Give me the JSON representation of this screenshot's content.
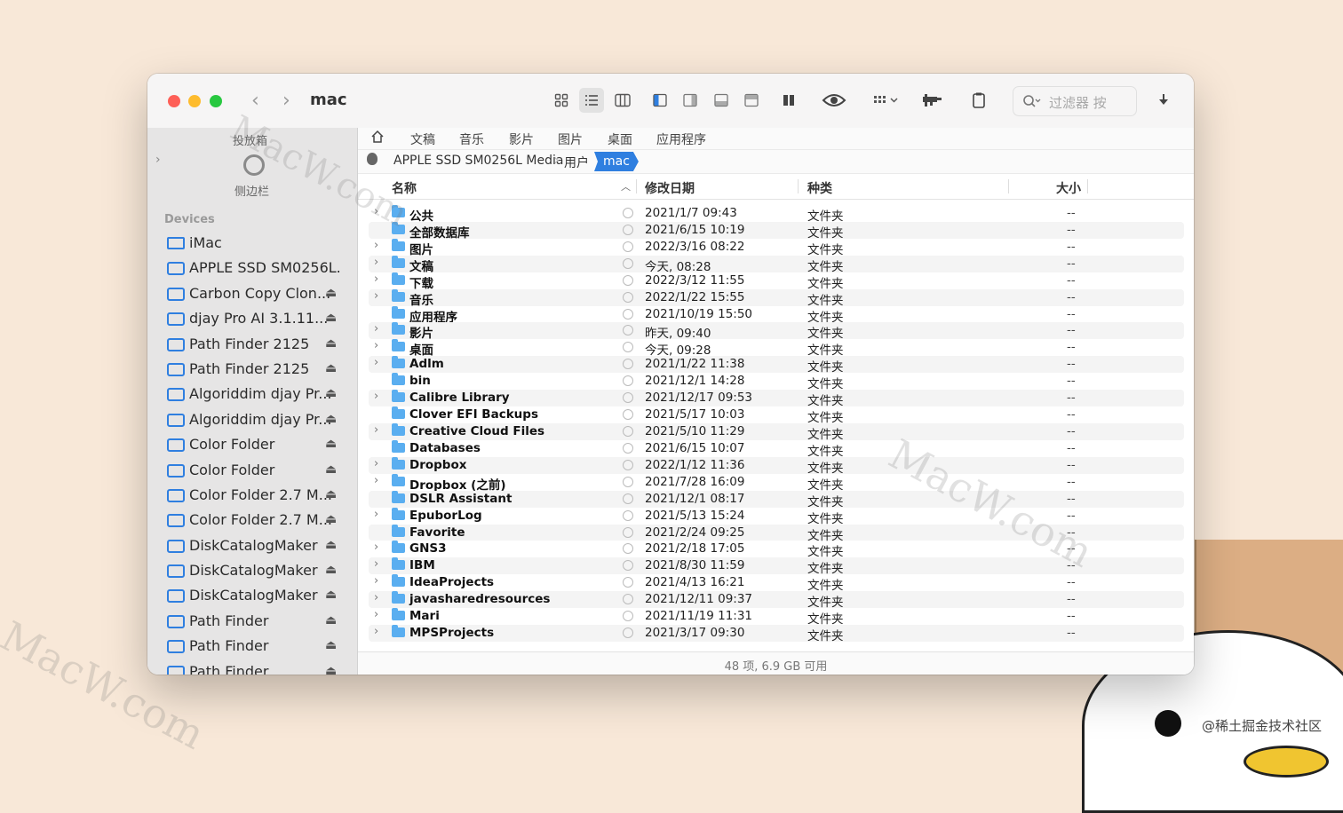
{
  "window": {
    "title": "mac",
    "search_placeholder": "过滤器 按"
  },
  "toolbar": {
    "icons": [
      "icon-view-grid",
      "list-view-icon",
      "column-view-icon",
      "left-pane-icon",
      "right-pane-icon",
      "bottom-pane-icon",
      "top-pane-icon",
      "dual-pane-icon",
      "eye-icon",
      "group-menu-icon",
      "tools-icon",
      "clipboard-icon",
      "download-icon"
    ]
  },
  "sidebar": {
    "top_label": "投放箱",
    "bottom_label": "侧边栏",
    "section_title": "Devices",
    "items": [
      {
        "label": "iMac",
        "type": "imac",
        "eject": false
      },
      {
        "label": "APPLE SSD SM0256L...",
        "type": "disk",
        "eject": false
      },
      {
        "label": "Carbon Copy Clon...",
        "type": "disk",
        "eject": true
      },
      {
        "label": "djay Pro AI 3.1.11...",
        "type": "disk",
        "eject": true
      },
      {
        "label": "Path Finder 2125",
        "type": "disk",
        "eject": true
      },
      {
        "label": "Path Finder 2125",
        "type": "disk",
        "eject": true
      },
      {
        "label": "Algoriddim djay Pr...",
        "type": "disk",
        "eject": true
      },
      {
        "label": "Algoriddim djay Pr...",
        "type": "disk",
        "eject": true
      },
      {
        "label": "Color Folder",
        "type": "disk",
        "eject": true
      },
      {
        "label": "Color Folder",
        "type": "disk",
        "eject": true
      },
      {
        "label": "Color Folder 2.7 M...",
        "type": "disk",
        "eject": true
      },
      {
        "label": "Color Folder 2.7 M...",
        "type": "disk",
        "eject": true
      },
      {
        "label": "DiskCatalogMaker",
        "type": "disk",
        "eject": true
      },
      {
        "label": "DiskCatalogMaker",
        "type": "disk",
        "eject": true
      },
      {
        "label": "DiskCatalogMaker",
        "type": "disk",
        "eject": true
      },
      {
        "label": "Path Finder",
        "type": "disk",
        "eject": true
      },
      {
        "label": "Path Finder",
        "type": "disk",
        "eject": true
      },
      {
        "label": "Path Finder",
        "type": "disk",
        "eject": true
      }
    ]
  },
  "favorites": [
    "文稿",
    "音乐",
    "影片",
    "图片",
    "桌面",
    "应用程序"
  ],
  "path": {
    "items": [
      "APPLE SSD SM0256L Media",
      "用户"
    ],
    "current": "mac"
  },
  "columns": {
    "name": "名称",
    "date": "修改日期",
    "kind": "种类",
    "size": "大小"
  },
  "files": [
    {
      "name": "公共",
      "date": "2021/1/7 09:43",
      "kind": "文件夹",
      "size": "--",
      "expandable": true
    },
    {
      "name": "全部数据库",
      "date": "2021/6/15 10:19",
      "kind": "文件夹",
      "size": "--",
      "expandable": false
    },
    {
      "name": "图片",
      "date": "2022/3/16 08:22",
      "kind": "文件夹",
      "size": "--",
      "expandable": true
    },
    {
      "name": "文稿",
      "date": "今天, 08:28",
      "kind": "文件夹",
      "size": "--",
      "expandable": true
    },
    {
      "name": "下载",
      "date": "2022/3/12 11:55",
      "kind": "文件夹",
      "size": "--",
      "expandable": true
    },
    {
      "name": "音乐",
      "date": "2022/1/22 15:55",
      "kind": "文件夹",
      "size": "--",
      "expandable": true
    },
    {
      "name": "应用程序",
      "date": "2021/10/19 15:50",
      "kind": "文件夹",
      "size": "--",
      "expandable": false
    },
    {
      "name": "影片",
      "date": "昨天, 09:40",
      "kind": "文件夹",
      "size": "--",
      "expandable": true
    },
    {
      "name": "桌面",
      "date": "今天, 09:28",
      "kind": "文件夹",
      "size": "--",
      "expandable": true
    },
    {
      "name": "Adlm",
      "date": "2021/1/22 11:38",
      "kind": "文件夹",
      "size": "--",
      "expandable": true
    },
    {
      "name": "bin",
      "date": "2021/12/1 14:28",
      "kind": "文件夹",
      "size": "--",
      "expandable": false
    },
    {
      "name": "Calibre Library",
      "date": "2021/12/17 09:53",
      "kind": "文件夹",
      "size": "--",
      "expandable": true
    },
    {
      "name": "Clover EFI Backups",
      "date": "2021/5/17 10:03",
      "kind": "文件夹",
      "size": "--",
      "expandable": false
    },
    {
      "name": "Creative Cloud Files",
      "date": "2021/5/10 11:29",
      "kind": "文件夹",
      "size": "--",
      "expandable": true
    },
    {
      "name": "Databases",
      "date": "2021/6/15 10:07",
      "kind": "文件夹",
      "size": "--",
      "expandable": false
    },
    {
      "name": "Dropbox",
      "date": "2022/1/12 11:36",
      "kind": "文件夹",
      "size": "--",
      "expandable": true
    },
    {
      "name": "Dropbox (之前)",
      "date": "2021/7/28 16:09",
      "kind": "文件夹",
      "size": "--",
      "expandable": true
    },
    {
      "name": "DSLR Assistant",
      "date": "2021/12/1 08:17",
      "kind": "文件夹",
      "size": "--",
      "expandable": false
    },
    {
      "name": "EpuborLog",
      "date": "2021/5/13 15:24",
      "kind": "文件夹",
      "size": "--",
      "expandable": true
    },
    {
      "name": "Favorite",
      "date": "2021/2/24 09:25",
      "kind": "文件夹",
      "size": "--",
      "expandable": false
    },
    {
      "name": "GNS3",
      "date": "2021/2/18 17:05",
      "kind": "文件夹",
      "size": "--",
      "expandable": true
    },
    {
      "name": "IBM",
      "date": "2021/8/30 11:59",
      "kind": "文件夹",
      "size": "--",
      "expandable": true
    },
    {
      "name": "IdeaProjects",
      "date": "2021/4/13 16:21",
      "kind": "文件夹",
      "size": "--",
      "expandable": true
    },
    {
      "name": "javasharedresources",
      "date": "2021/12/11 09:37",
      "kind": "文件夹",
      "size": "--",
      "expandable": true
    },
    {
      "name": "Mari",
      "date": "2021/11/19 11:31",
      "kind": "文件夹",
      "size": "--",
      "expandable": true
    },
    {
      "name": "MPSProjects",
      "date": "2021/3/17 09:30",
      "kind": "文件夹",
      "size": "--",
      "expandable": true
    }
  ],
  "status": "48 项, 6.9 GB 可用",
  "watermark": "MacW.com",
  "credit": "@稀土掘金技术社区"
}
